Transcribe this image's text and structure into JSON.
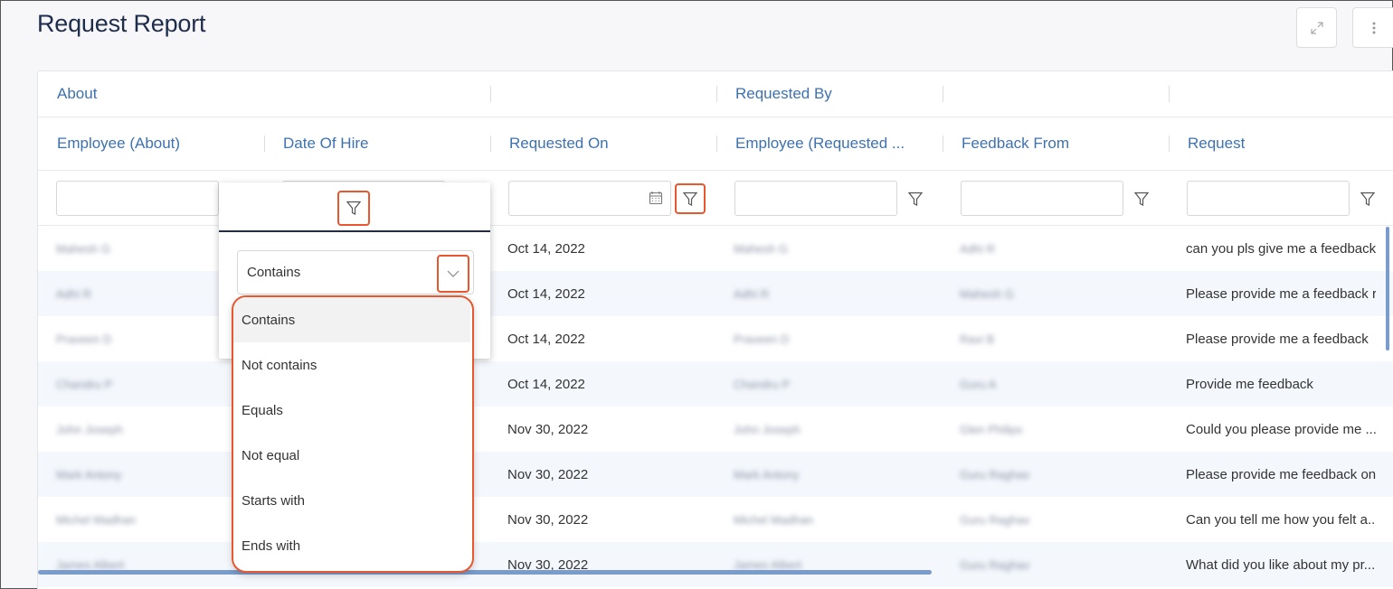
{
  "page": {
    "title": "Request Report"
  },
  "toolbar": {
    "expand_icon": "expand-icon",
    "more_icon": "more-vertical-icon"
  },
  "grid": {
    "group_headers": [
      "About",
      "",
      "Requested By",
      "",
      ""
    ],
    "columns": [
      "Employee (About)",
      "Date Of Hire",
      "Requested On",
      "Employee (Requested ...",
      "Feedback From",
      "Request"
    ],
    "rows": [
      {
        "employee": "Mahesh G",
        "requested_on": "Oct 14, 2022",
        "requested_by": "Mahesh G",
        "feedback_from": "Adhi R",
        "request": "can you pls give me a feedback ..."
      },
      {
        "employee": "Adhi R",
        "requested_on": "Oct 14, 2022",
        "requested_by": "Adhi R",
        "feedback_from": "Mahesh G",
        "request": "Please provide me a feedback r..."
      },
      {
        "employee": "Praveen D",
        "requested_on": "Oct 14, 2022",
        "requested_by": "Praveen D",
        "feedback_from": "Ravi B",
        "request": "Please provide me a feedback"
      },
      {
        "employee": "Chandru P",
        "requested_on": "Oct 14, 2022",
        "requested_by": "Chandru P",
        "feedback_from": "Guru A",
        "request": "Provide me feedback"
      },
      {
        "employee": "John Joseph",
        "requested_on": "Nov 30, 2022",
        "requested_by": "John Joseph",
        "feedback_from": "Glen Philips",
        "request": "Could you please provide me ..."
      },
      {
        "employee": "Mark Antony",
        "requested_on": "Nov 30, 2022",
        "requested_by": "Mark Antony",
        "feedback_from": "Guru Raghav",
        "request": "Please provide me feedback on..."
      },
      {
        "employee": "Michel Madhan",
        "requested_on": "Nov 30, 2022",
        "requested_by": "Michel Madhan",
        "feedback_from": "Guru Raghav",
        "request": "Can you tell me how you felt a..."
      },
      {
        "employee": "James Albert",
        "requested_on": "Nov 30, 2022",
        "requested_by": "James Albert",
        "feedback_from": "Guru Raghav",
        "request": "What did you like about my pr..."
      }
    ]
  },
  "filter_popup": {
    "operator": "Contains",
    "options": [
      "Contains",
      "Not contains",
      "Equals",
      "Not equal",
      "Starts with",
      "Ends with"
    ]
  },
  "colors": {
    "accent": "#3e71b0",
    "title": "#1f2d4d",
    "highlight": "#e8572d"
  }
}
